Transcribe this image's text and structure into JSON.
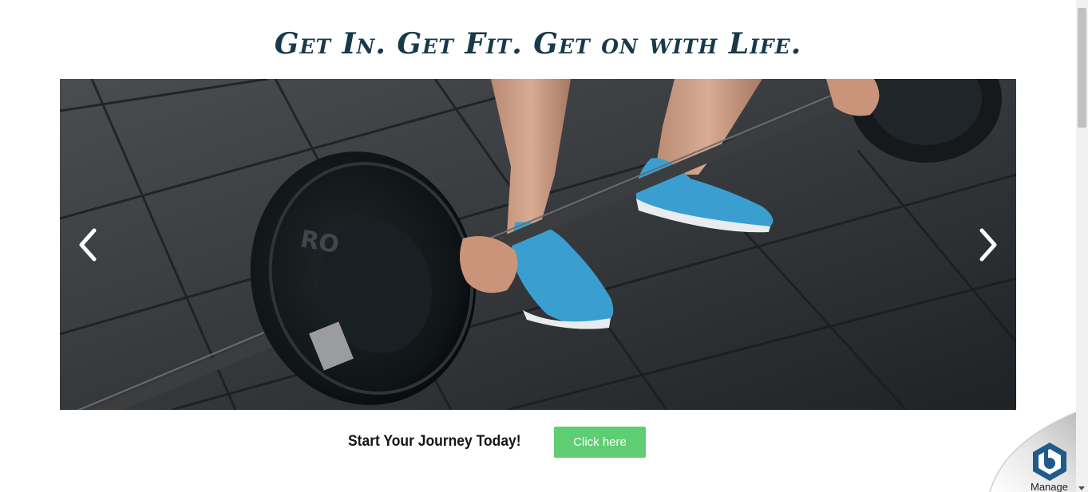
{
  "headline": "Get In. Get Fit. Get on with Life.",
  "carousel": {
    "prev_icon": "chevron-left-icon",
    "next_icon": "chevron-right-icon",
    "plate_text": "RO"
  },
  "cta": {
    "text": "Start Your Journey Today!",
    "button_label": "Click here",
    "button_color": "#5fcd72"
  },
  "colors": {
    "headline": "#173a4a",
    "floor": "#2d3033",
    "shoes": "#3a9fd0"
  },
  "widget": {
    "icon": "privacy-shield-icon",
    "label": "Manage"
  }
}
